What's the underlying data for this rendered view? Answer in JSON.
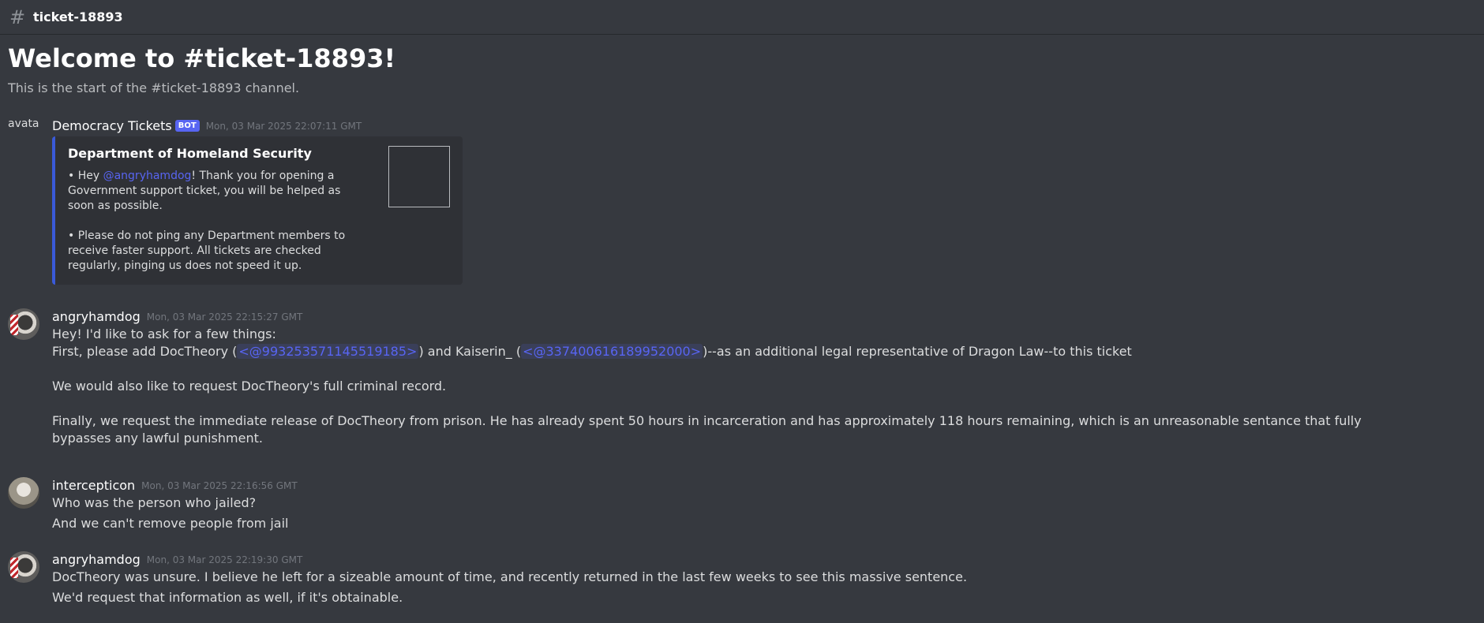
{
  "header": {
    "channel_name": "ticket-18893",
    "hash_icon": "hash-icon"
  },
  "welcome": {
    "title": "Welcome to #ticket-18893!",
    "subtitle": "This is the start of the #ticket-18893 channel."
  },
  "messages": [
    {
      "author": "Democracy Tickets",
      "bot_tag": "BOT",
      "avatar_alt": "avatar",
      "timestamp": "Mon, 03 Mar 2025 22:07:11 GMT",
      "embed": {
        "title": "Department of Homeland Security",
        "line1_prefix": "• Hey ",
        "line1_mention": "@angryhamdog",
        "line1_suffix": "! Thank you for opening a Government support ticket, you will be helped as soon as possible.",
        "line2": "• Please do not ping any Department members to receive faster support. All tickets are checked regularly, pinging us does not speed it up."
      }
    },
    {
      "author": "angryhamdog",
      "timestamp": "Mon, 03 Mar 2025 22:15:27 GMT",
      "line1": "Hey! I'd like to ask for a few things:",
      "line2_a": "First, please add DocTheory (",
      "line2_mention1": "<@993253571145519185>",
      "line2_b": ") and Kaiserin_ (",
      "line2_mention2": "<@337400616189952000>",
      "line2_c": ")--as an additional legal representative of Dragon Law--to this ticket",
      "line3": "We would also like to request DocTheory's full criminal record.",
      "line4": "Finally, we request the immediate release of DocTheory from prison. He has already spent 50 hours in incarceration and has approximately 118 hours remaining, which is an unreasonable sentance that fully bypasses any lawful punishment."
    },
    {
      "author": "intercepticon",
      "timestamp": "Mon, 03 Mar 2025 22:16:56 GMT",
      "line1": "Who was the person who jailed?",
      "line2": "And we can't remove people from jail"
    },
    {
      "author": "angryhamdog",
      "timestamp": "Mon, 03 Mar 2025 22:19:30 GMT",
      "line1": "DocTheory was unsure. I believe he left for a sizeable amount of time, and recently returned in the last few weeks to see this massive sentence.",
      "line2": "We'd request that information as well, if it's obtainable."
    }
  ],
  "colors": {
    "background": "#36393f",
    "embed_bg": "#2f3136",
    "embed_border": "#3a5ad9",
    "mention": "#5865f2",
    "bot_tag": "#5865f2"
  }
}
